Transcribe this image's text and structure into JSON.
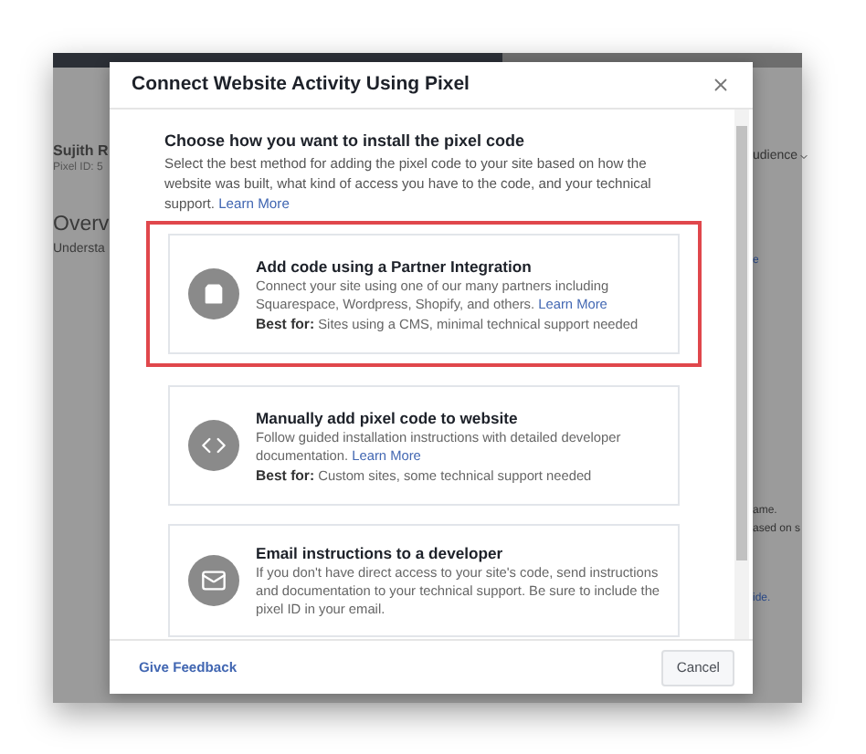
{
  "background": {
    "account_name": "Sujith R",
    "pixel_id": "Pixel ID: 5",
    "heading": "Overv",
    "subheading": "Understa",
    "menu": "udience",
    "right_texts": [
      "e",
      "ame.",
      "ased on s",
      "ide."
    ]
  },
  "dialog": {
    "title": "Connect Website Activity Using Pixel",
    "heading": "Choose how you want to install the pixel code",
    "intro": "Select the best method for adding the pixel code to your site based on how the website was built, what kind of access you have to the code, and your technical support.",
    "intro_link": "Learn More",
    "options": [
      {
        "kind": "bag",
        "title": "Add code using a Partner Integration",
        "description": "Connect your site using one of our many partners including Squarespace, Wordpress, Shopify, and others.",
        "link": "Learn More",
        "best_for_label": "Best for:",
        "best_for": "Sites using a CMS, minimal technical support needed",
        "highlighted": true
      },
      {
        "kind": "code",
        "title": "Manually add pixel code to website",
        "description": "Follow guided installation instructions with detailed developer documentation.",
        "link": "Learn More",
        "best_for_label": "Best for:",
        "best_for": "Custom sites, some technical support needed",
        "highlighted": false
      },
      {
        "kind": "mail",
        "title": "Email instructions to a developer",
        "description": "If you don't have direct access to your site's code, send instructions and documentation to your technical support. Be sure to include the pixel ID in your email.",
        "highlighted": false
      }
    ],
    "feedback": "Give Feedback",
    "cancel": "Cancel"
  }
}
